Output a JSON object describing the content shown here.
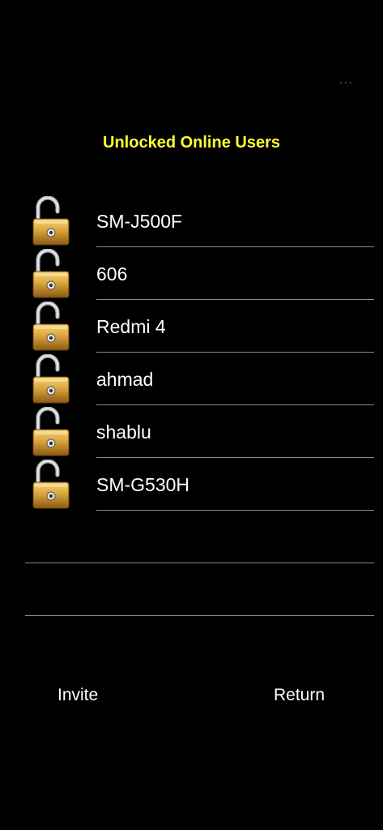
{
  "header": {
    "title": "Unlocked Online Users",
    "title_color": "#ffff33"
  },
  "users": [
    {
      "name": "SM-J500F",
      "icon": "unlocked-padlock-icon"
    },
    {
      "name": "606",
      "icon": "unlocked-padlock-icon"
    },
    {
      "name": "Redmi 4",
      "icon": "unlocked-padlock-icon"
    },
    {
      "name": "ahmad",
      "icon": "unlocked-padlock-icon"
    },
    {
      "name": "shablu",
      "icon": "unlocked-padlock-icon"
    },
    {
      "name": "SM-G530H",
      "icon": "unlocked-padlock-icon"
    }
  ],
  "footer": {
    "invite_label": "Invite",
    "return_label": "Return"
  },
  "colors": {
    "background": "#000000",
    "text": "#ffffff",
    "divider": "#8a8a8a",
    "lock_gold": "#d9a53a",
    "shackle_silver": "#b8bcc0"
  }
}
